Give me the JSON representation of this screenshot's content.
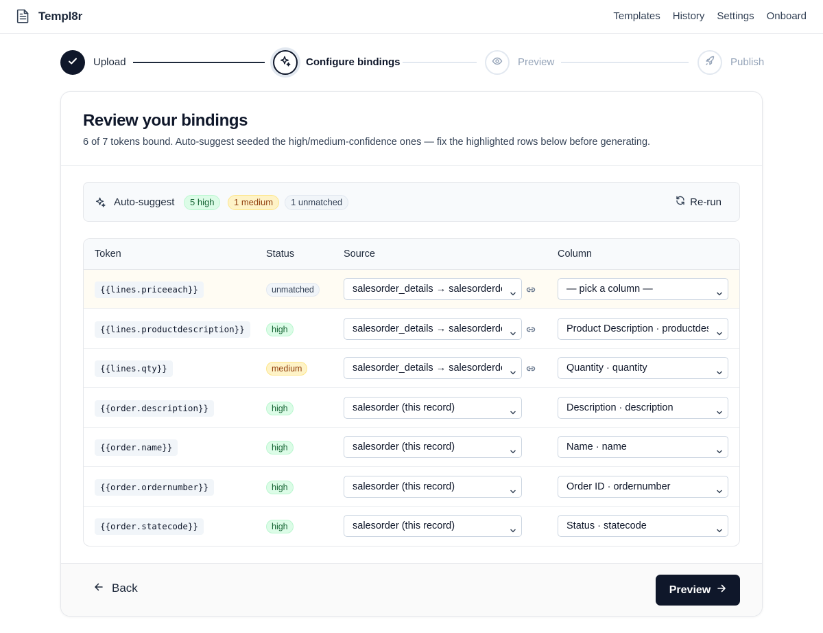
{
  "app": {
    "name": "Templ8r"
  },
  "nav": [
    "Templates",
    "History",
    "Settings",
    "Onboard"
  ],
  "steps": [
    {
      "label": "Upload",
      "state": "done",
      "icon": "check-icon"
    },
    {
      "label": "Configure bindings",
      "state": "active",
      "icon": "sparkles-icon"
    },
    {
      "label": "Preview",
      "state": "todo",
      "icon": "eye-icon"
    },
    {
      "label": "Publish",
      "state": "todo",
      "icon": "rocket-icon"
    }
  ],
  "card": {
    "title": "Review your bindings",
    "subtitle": "6 of 7 tokens bound. Auto-suggest seeded the high/medium-confidence ones — fix the highlighted rows below before generating."
  },
  "autosuggest": {
    "label": "Auto-suggest",
    "high": "5 high",
    "medium": "1 medium",
    "unmatched": "1 unmatched",
    "rerun": "Re-run"
  },
  "table": {
    "headers": {
      "token": "Token",
      "status": "Status",
      "source": "Source",
      "column": "Column"
    },
    "rows": [
      {
        "token": "{{lines.priceeach}}",
        "status": "unmatched",
        "source": "salesorder_details → salesorderdetails",
        "linked": true,
        "column": "— pick a column —"
      },
      {
        "token": "{{lines.productdescription}}",
        "status": "high",
        "source": "salesorder_details → salesorderdetails",
        "linked": true,
        "column": "Product Description · productdescription"
      },
      {
        "token": "{{lines.qty}}",
        "status": "medium",
        "source": "salesorder_details → salesorderdetails",
        "linked": true,
        "column": "Quantity · quantity"
      },
      {
        "token": "{{order.description}}",
        "status": "high",
        "source": "salesorder (this record)",
        "linked": false,
        "column": "Description · description"
      },
      {
        "token": "{{order.name}}",
        "status": "high",
        "source": "salesorder (this record)",
        "linked": false,
        "column": "Name · name"
      },
      {
        "token": "{{order.ordernumber}}",
        "status": "high",
        "source": "salesorder (this record)",
        "linked": false,
        "column": "Order ID · ordernumber"
      },
      {
        "token": "{{order.statecode}}",
        "status": "high",
        "source": "salesorder (this record)",
        "linked": false,
        "column": "Status · statecode"
      }
    ]
  },
  "footer": {
    "back": "Back",
    "next": "Preview"
  },
  "colors": {
    "primary": "#0f172a",
    "border": "#e5e7eb",
    "high": "#dcfce7",
    "medium": "#fef3c7",
    "unmatched": "#f1f5f9"
  }
}
